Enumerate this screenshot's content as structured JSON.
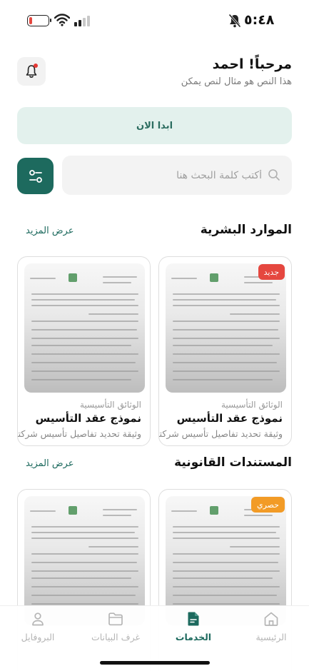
{
  "status_bar": {
    "time": "٥:٤٨",
    "battery_level": 0.15
  },
  "header": {
    "greeting": "مرحباً! احمد",
    "subtitle": "هذا النص هو مثال لنص يمكن"
  },
  "start_button": {
    "label": "ابدا الان"
  },
  "search": {
    "placeholder": "أكتب كلمة البحث هنا",
    "value": ""
  },
  "sections": [
    {
      "title": "الموارد البشرية",
      "more_label": "عرض المزيد",
      "cards": [
        {
          "badge": "جديد",
          "badge_color": "#e5473f",
          "category": "الوثائق التأسيسية",
          "name": "نموذج عقد التأسيس",
          "description": "وثيقة تحديد تفاصيل تأسيس شركتك"
        },
        {
          "badge": "",
          "badge_color": "",
          "category": "الوثائق التأسيسية",
          "name": "نموذج عقد التأسيس",
          "description": "وثيقة تحديد تفاصيل تأسيس شركتك"
        }
      ]
    },
    {
      "title": "المستندات القانونية",
      "more_label": "عرض المزيد",
      "cards": [
        {
          "badge": "حصري",
          "badge_color": "#f29b26",
          "category": "",
          "name": "",
          "description": ""
        },
        {
          "badge": "",
          "badge_color": "",
          "category": "",
          "name": "",
          "description": ""
        }
      ]
    }
  ],
  "bottom_nav": [
    {
      "label": "الرئيسية",
      "icon": "home-icon",
      "active": false
    },
    {
      "label": "الخدمات",
      "icon": "document-icon",
      "active": true
    },
    {
      "label": "غرف البيانات",
      "icon": "folder-icon",
      "active": false
    },
    {
      "label": "البروفايل",
      "icon": "user-icon",
      "active": false
    }
  ],
  "colors": {
    "primary": "#1d6a5e",
    "start_bg": "#e3f1ed",
    "badge_new": "#e5473f",
    "badge_exclusive": "#f29b26"
  }
}
